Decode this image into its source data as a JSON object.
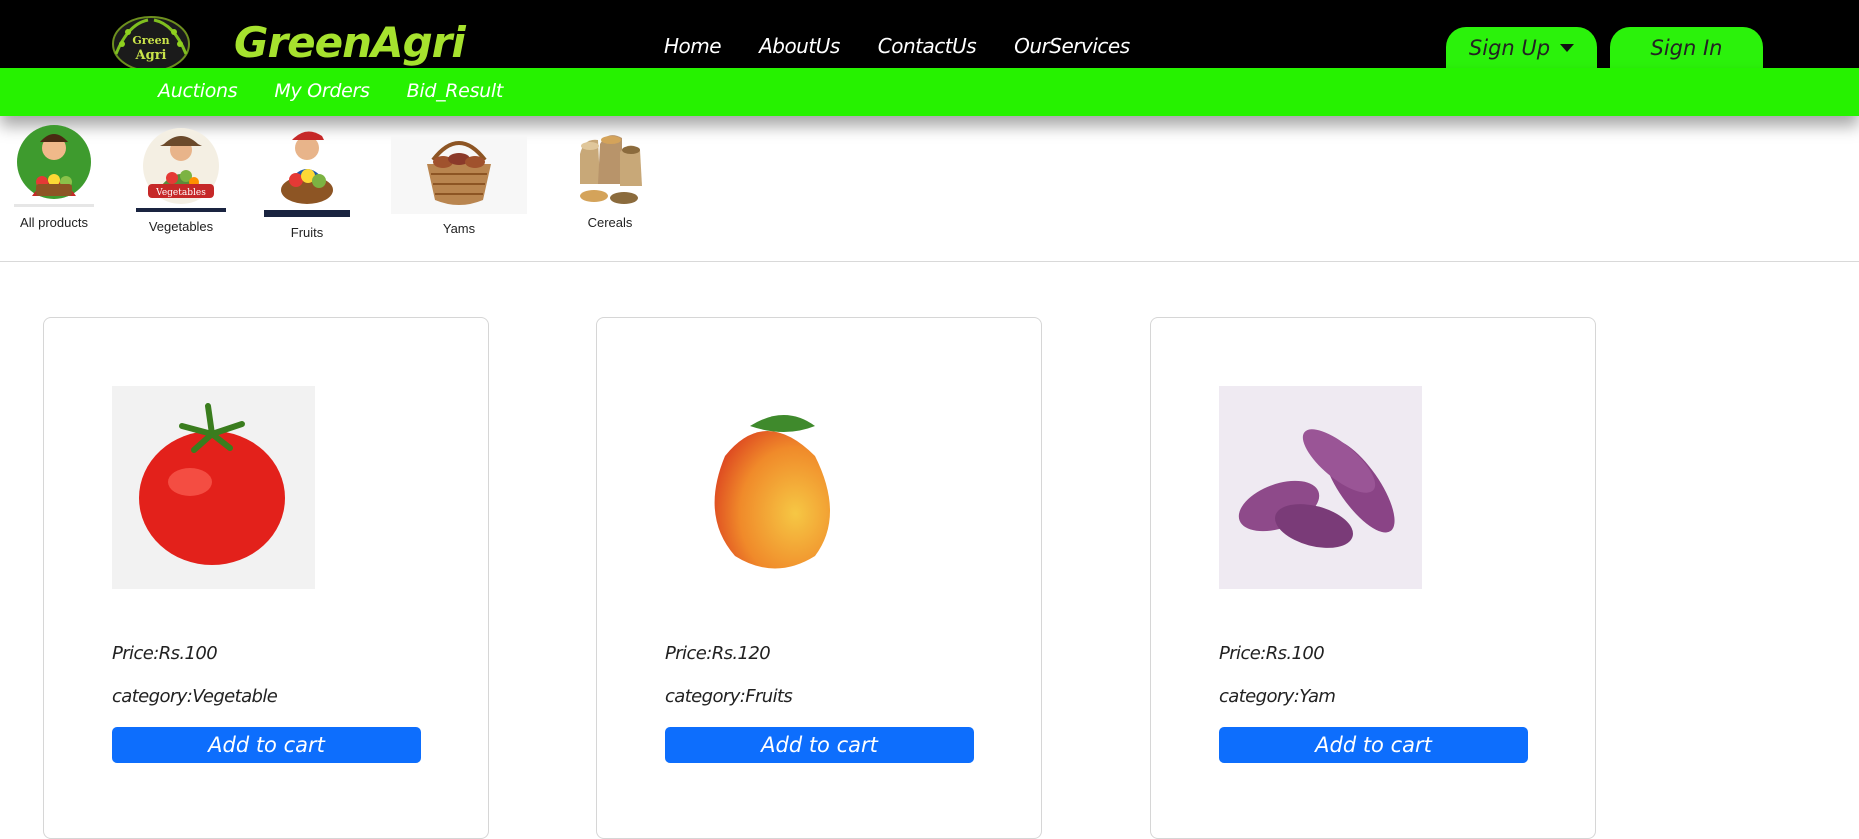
{
  "header": {
    "logo_text_line1": "Green",
    "logo_text_line2": "Agri",
    "brand": "GreenAgri",
    "nav": [
      "Home",
      "AboutUs",
      "ContactUs",
      "OurServices"
    ],
    "signup_label": "Sign Up",
    "signin_label": "Sign In",
    "colors": {
      "bar": "#000000",
      "brand": "#a6e22e",
      "button": "#2bf20b"
    }
  },
  "subnav": {
    "items": [
      "Auctions",
      "My Orders",
      "Bid_Result"
    ],
    "color": "#26f200"
  },
  "categories": [
    {
      "label": "All products",
      "icon": "farmer-produce-icon"
    },
    {
      "label": "Vegetables",
      "icon": "vegetables-farmer-icon"
    },
    {
      "label": "Fruits",
      "icon": "fruits-farmer-icon"
    },
    {
      "label": "Yams",
      "icon": "yam-basket-icon"
    },
    {
      "label": "Cereals",
      "icon": "cereal-sacks-icon"
    }
  ],
  "products": [
    {
      "image": "tomato",
      "price": "Price:Rs.100",
      "category": "category:Vegetable",
      "button": "Add to cart"
    },
    {
      "image": "mango",
      "price": "Price:Rs.120",
      "category": "category:Fruits",
      "button": "Add to cart"
    },
    {
      "image": "sweet-potato",
      "price": "Price:Rs.100",
      "category": "category:Yam",
      "button": "Add to cart"
    }
  ],
  "accent": "#0d6efd"
}
